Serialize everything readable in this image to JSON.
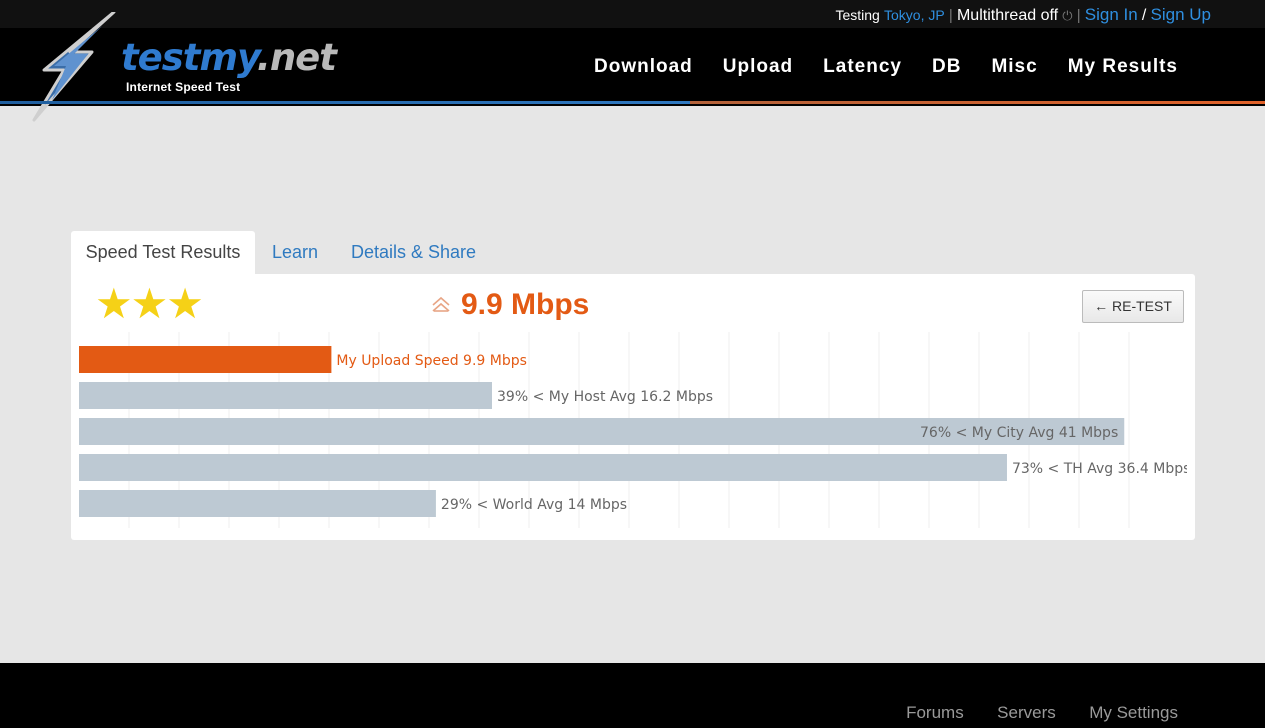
{
  "topbar": {
    "testing_label": "Testing",
    "location": "Tokyo, JP",
    "separator": "|",
    "multithread": "Multithread off",
    "power_glyph": "⏻",
    "sign_in": "Sign In",
    "slash": "/",
    "sign_up": "Sign Up"
  },
  "logo": {
    "text_a": "testmy",
    "text_b": ".net",
    "tagline": "Internet Speed Test",
    "icon": "lightning-bolt-icon"
  },
  "nav": {
    "items": [
      "Download",
      "Upload",
      "Latency",
      "DB",
      "Misc",
      "My Results"
    ]
  },
  "tabs": {
    "results": "Speed Test Results",
    "learn": "Learn",
    "details": "Details & Share"
  },
  "result": {
    "stars": "★★★",
    "rating": 3,
    "icon": "upload-arrow-icon",
    "speed": "9.9 Mbps",
    "retest": "← RE-TEST"
  },
  "chart_data": {
    "type": "bar",
    "orientation": "horizontal",
    "xlim": [
      0,
      41.5
    ],
    "grid": true,
    "categories": [
      "My Upload Speed 9.9 Mbps",
      "39% < My Host Avg 16.2 Mbps",
      "76% < My City Avg 41 Mbps",
      "73% < TH Avg 36.4 Mbps",
      "29% < World Avg 14 Mbps"
    ],
    "values": [
      9.9,
      16.2,
      41,
      36.4,
      14
    ],
    "colors": [
      "#e35a14",
      "#bdc9d3",
      "#bdc9d3",
      "#bdc9d3",
      "#bdc9d3"
    ],
    "label_colors": [
      "#e35a14",
      "#666666",
      "#666666",
      "#666666",
      "#666666"
    ],
    "label_inside": [
      false,
      false,
      true,
      false,
      false
    ]
  },
  "footer": {
    "links": [
      "Forums",
      "Servers",
      "My Settings"
    ]
  }
}
